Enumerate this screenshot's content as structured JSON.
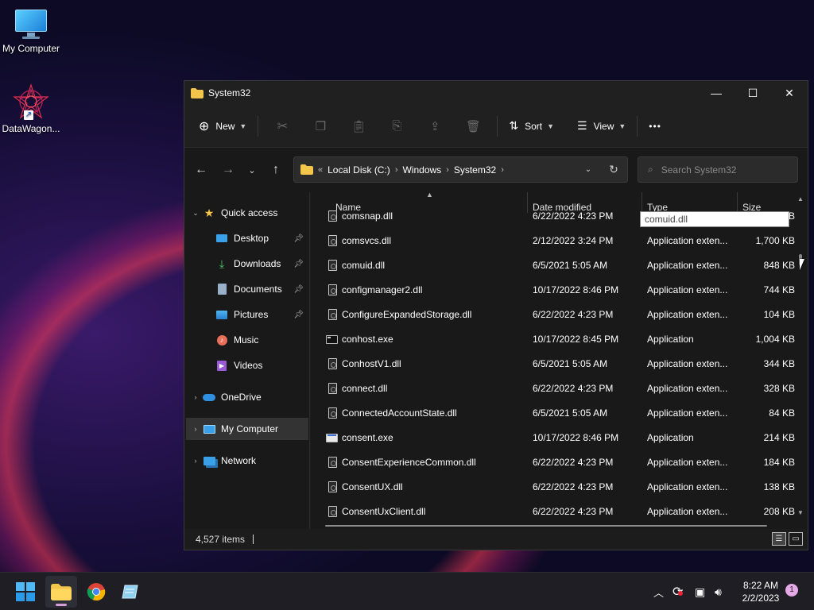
{
  "desktop": {
    "icons": [
      {
        "label": "My Computer"
      },
      {
        "label": "DataWagon..."
      }
    ]
  },
  "window": {
    "title": "System32",
    "toolbar": {
      "new_label": "New",
      "sort_label": "Sort",
      "view_label": "View",
      "more_label": "•••"
    },
    "address": {
      "overflow": "«",
      "crumbs": [
        "Local Disk (C:)",
        "Windows",
        "System32"
      ]
    },
    "search": {
      "placeholder": "Search System32"
    },
    "nav": {
      "quick_access": "Quick access",
      "desktop": "Desktop",
      "downloads": "Downloads",
      "documents": "Documents",
      "pictures": "Pictures",
      "music": "Music",
      "videos": "Videos",
      "onedrive": "OneDrive",
      "my_computer": "My Computer",
      "network": "Network"
    },
    "columns": {
      "name": "Name",
      "date": "Date modified",
      "type": "Type",
      "size": "Size"
    },
    "rename_value": "comuid.dll",
    "files": [
      {
        "name": "comsnap.dll",
        "date": "6/22/2022 4:23 PM",
        "type": "",
        "size": "B"
      },
      {
        "name": "comsvcs.dll",
        "date": "2/12/2022 3:24 PM",
        "type": "Application exten...",
        "size": "1,700 KB"
      },
      {
        "name": "comuid.dll",
        "date": "6/5/2021 5:05 AM",
        "type": "Application exten...",
        "size": "848 KB"
      },
      {
        "name": "configmanager2.dll",
        "date": "10/17/2022 8:46 PM",
        "type": "Application exten...",
        "size": "744 KB"
      },
      {
        "name": "ConfigureExpandedStorage.dll",
        "date": "6/22/2022 4:23 PM",
        "type": "Application exten...",
        "size": "104 KB"
      },
      {
        "name": "conhost.exe",
        "date": "10/17/2022 8:45 PM",
        "type": "Application",
        "size": "1,004 KB"
      },
      {
        "name": "ConhostV1.dll",
        "date": "6/5/2021 5:05 AM",
        "type": "Application exten...",
        "size": "344 KB"
      },
      {
        "name": "connect.dll",
        "date": "6/22/2022 4:23 PM",
        "type": "Application exten...",
        "size": "328 KB"
      },
      {
        "name": "ConnectedAccountState.dll",
        "date": "6/5/2021 5:05 AM",
        "type": "Application exten...",
        "size": "84 KB"
      },
      {
        "name": "consent.exe",
        "date": "10/17/2022 8:46 PM",
        "type": "Application",
        "size": "214 KB"
      },
      {
        "name": "ConsentExperienceCommon.dll",
        "date": "6/22/2022 4:23 PM",
        "type": "Application exten...",
        "size": "184 KB"
      },
      {
        "name": "ConsentUX.dll",
        "date": "6/22/2022 4:23 PM",
        "type": "Application exten...",
        "size": "138 KB"
      },
      {
        "name": "ConsentUxClient.dll",
        "date": "6/22/2022 4:23 PM",
        "type": "Application exten...",
        "size": "208 KB"
      }
    ],
    "status": {
      "item_count": "4,527 items"
    }
  },
  "taskbar": {
    "time": "8:22 AM",
    "date": "2/2/2023",
    "notification_count": "1"
  },
  "colors": {
    "accent": "#d79bd9",
    "folder": "#f3c54b",
    "window_bg": "#191919"
  }
}
